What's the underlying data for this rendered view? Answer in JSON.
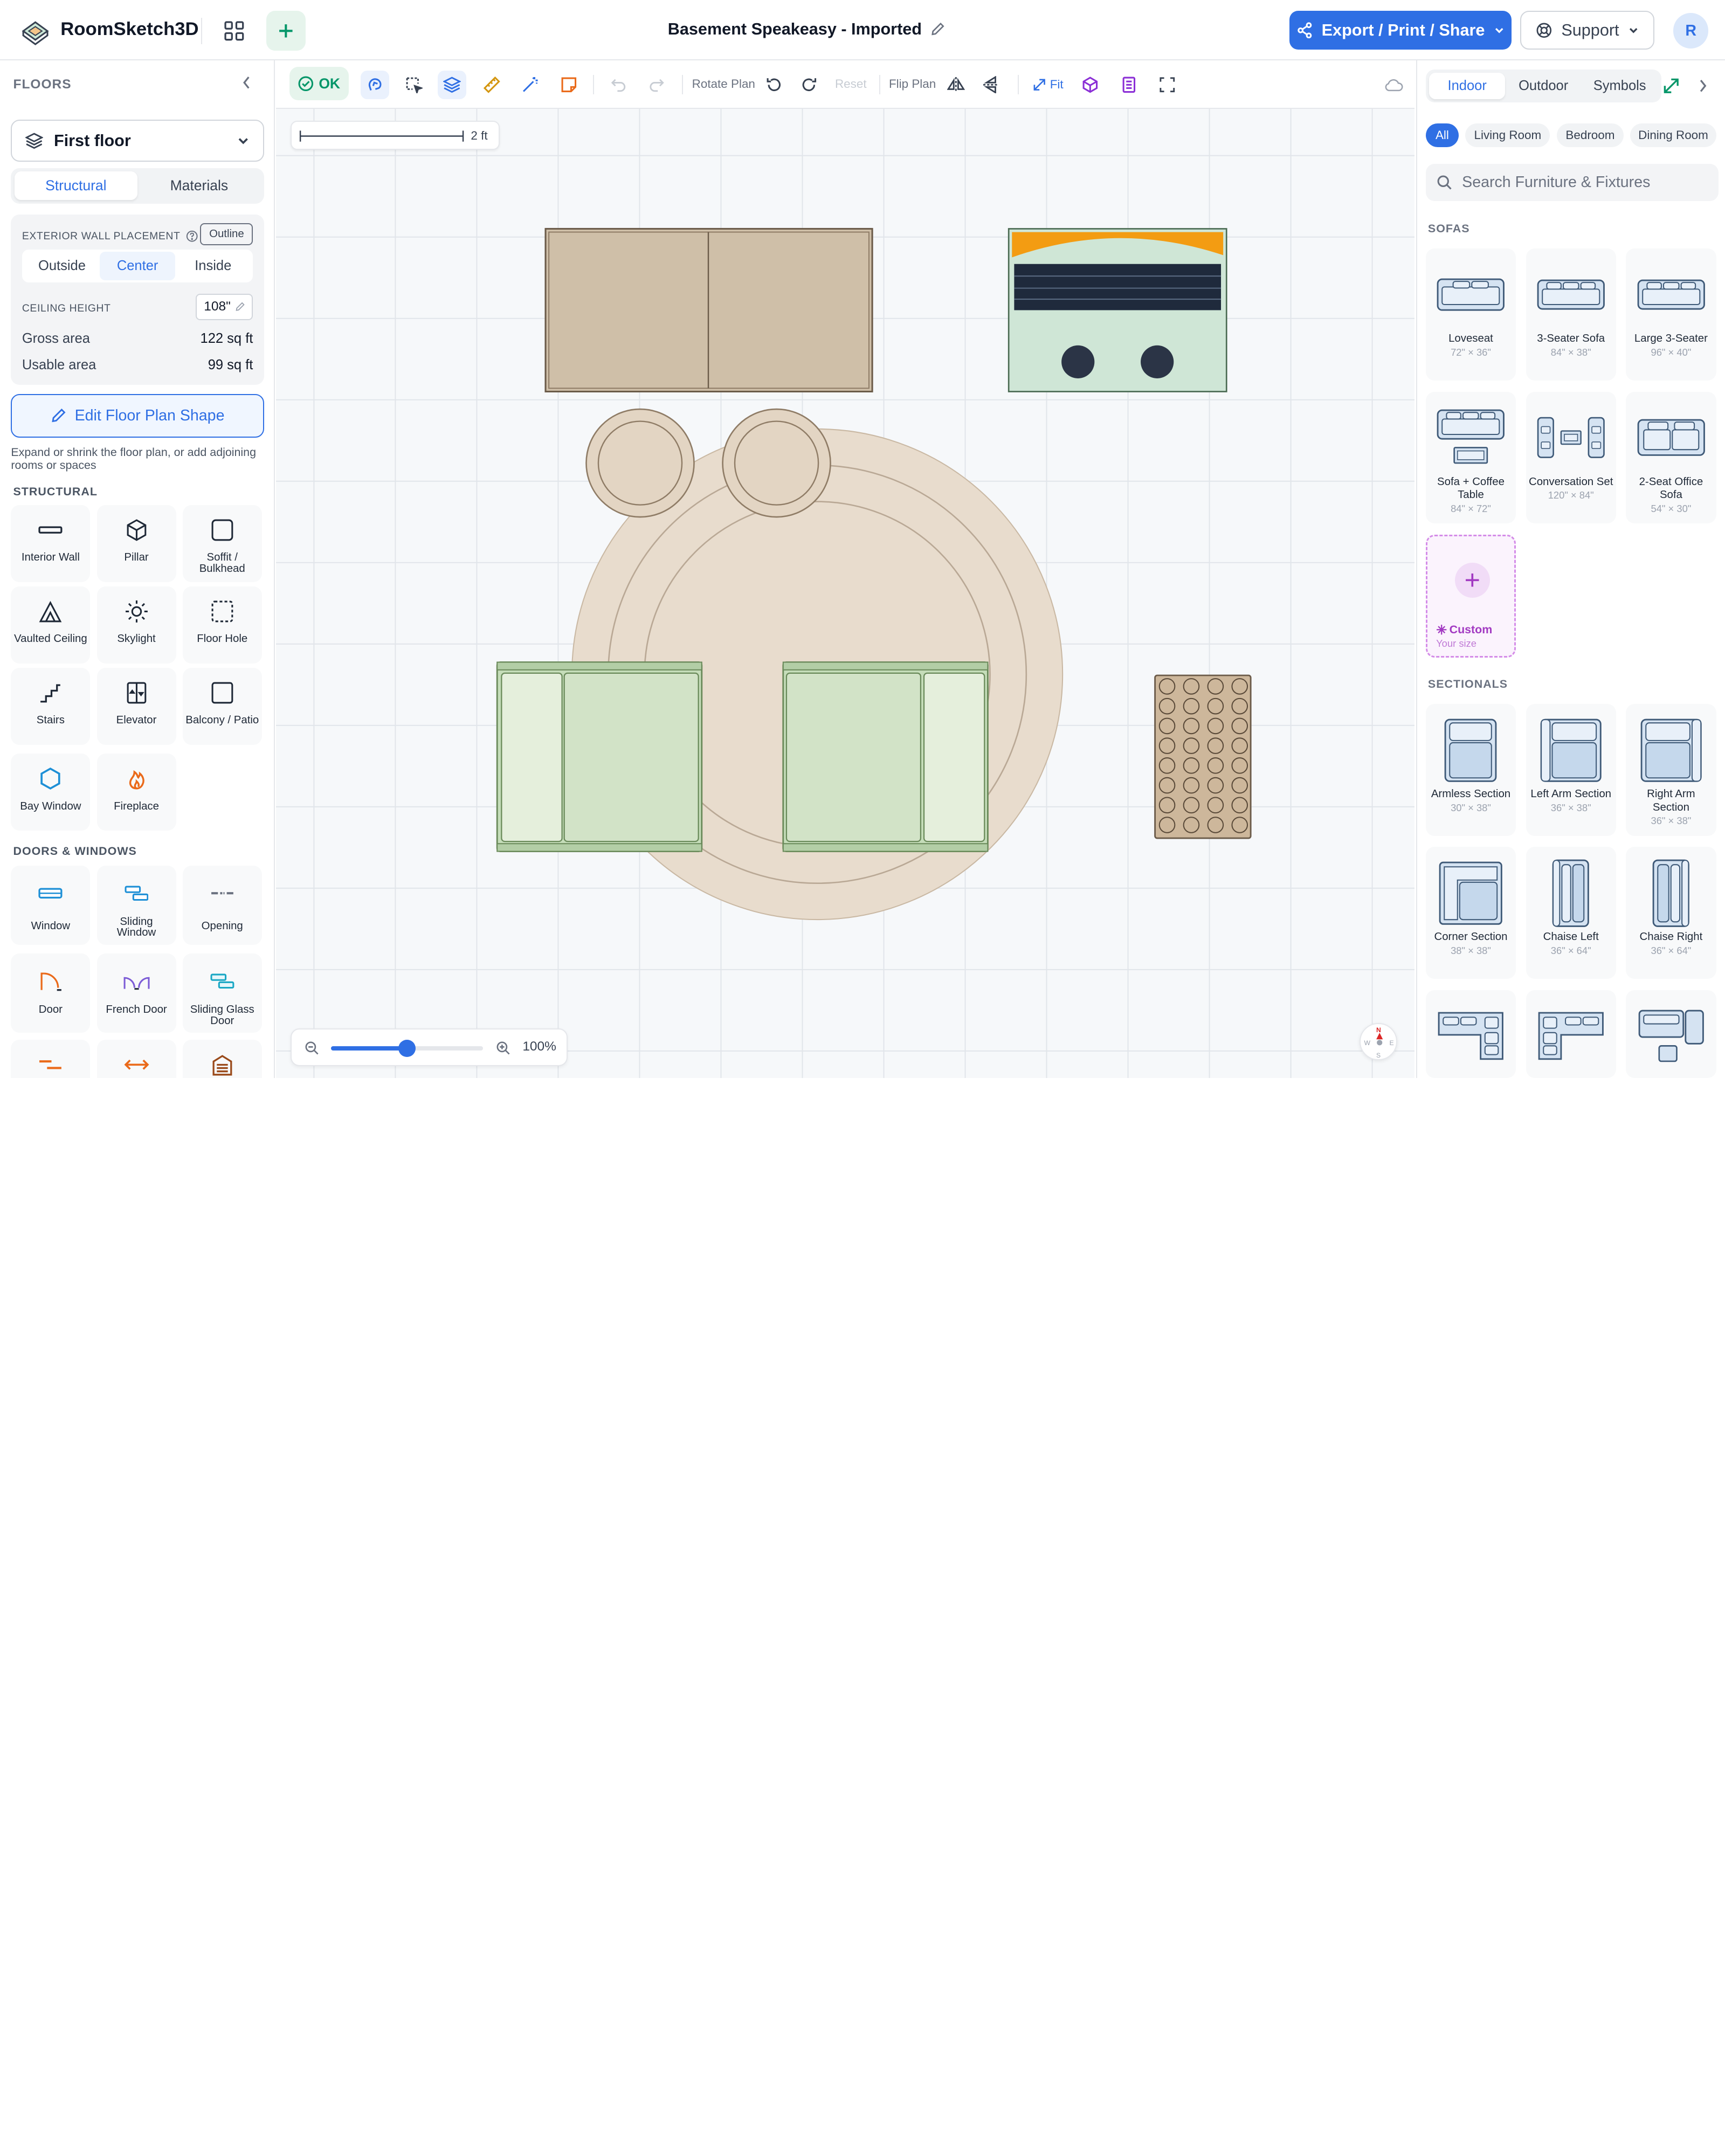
{
  "header": {
    "brand": "RoomSketch3D",
    "title": "Basement Speakeasy - Imported",
    "export_label": "Export / Print / Share",
    "support_label": "Support",
    "avatar_initial": "R"
  },
  "left": {
    "section_title": "FLOORS",
    "floor_name": "First floor",
    "tabs": [
      "Structural",
      "Materials"
    ],
    "exterior_label": "EXTERIOR WALL PLACEMENT",
    "outline_label": "Outline",
    "placement_options": [
      "Outside",
      "Center",
      "Inside"
    ],
    "ceiling_label": "CEILING HEIGHT",
    "ceiling_value": "108\"",
    "gross_label": "Gross area",
    "gross_value": "122 sq ft",
    "usable_label": "Usable area",
    "usable_value": "99 sq ft",
    "edit_shape_label": "Edit Floor Plan Shape",
    "edit_hint": "Expand or shrink the floor plan, or add adjoining rooms or spaces",
    "structural_title": "STRUCTURAL",
    "structural": [
      "Interior Wall",
      "Pillar",
      "Soffit / Bulkhead",
      "Vaulted Ceiling",
      "Skylight",
      "Floor Hole",
      "Stairs",
      "Elevator",
      "Balcony / Patio",
      "Bay Window",
      "Fireplace"
    ],
    "doors_title": "DOORS & WINDOWS",
    "doors": [
      "Window",
      "Sliding Window",
      "Opening",
      "Door",
      "French Door",
      "Sliding Glass Door"
    ]
  },
  "toolbar": {
    "ok_label": "OK",
    "rotate_label": "Rotate Plan",
    "reset_label": "Reset",
    "flip_label": "Flip Plan",
    "fit_label": "Fit"
  },
  "canvas": {
    "scale_label": "2 ft",
    "zoom_label": "100%",
    "zoom_level": 0.5,
    "compass": {
      "n": "N",
      "w": "W",
      "e": "E",
      "s": "S"
    }
  },
  "right": {
    "tabs": [
      "Indoor",
      "Outdoor",
      "Symbols"
    ],
    "filters": [
      "All",
      "Living Room",
      "Bedroom",
      "Dining Room"
    ],
    "search_placeholder": "Search Furniture & Fixtures",
    "sofas_title": "SOFAS",
    "sofas": [
      {
        "name": "Loveseat",
        "dims": "72\" × 36\""
      },
      {
        "name": "3-Seater Sofa",
        "dims": "84\" × 38\""
      },
      {
        "name": "Large 3-Seater",
        "dims": "96\" × 40\""
      },
      {
        "name": "Sofa + Coffee Table",
        "dims": "84\" × 72\""
      },
      {
        "name": "Conversation Set",
        "dims": "120\" × 84\""
      },
      {
        "name": "2-Seat Office Sofa",
        "dims": "54\" × 30\""
      }
    ],
    "custom_label": "Custom",
    "custom_sub": "Your size",
    "sectionals_title": "SECTIONALS",
    "sectionals": [
      {
        "name": "Armless Section",
        "dims": "30\" × 38\""
      },
      {
        "name": "Left Arm Section",
        "dims": "36\" × 38\""
      },
      {
        "name": "Right Arm Section",
        "dims": "36\" × 38\""
      },
      {
        "name": "Corner Section",
        "dims": "38\" × 38\""
      },
      {
        "name": "Chaise Left",
        "dims": "36\" × 64\""
      },
      {
        "name": "Chaise Right",
        "dims": "36\" × 64\""
      }
    ]
  }
}
